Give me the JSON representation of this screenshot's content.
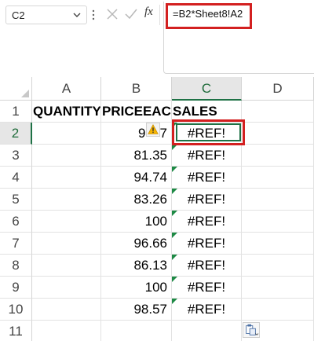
{
  "formula_bar": {
    "name_box": "C2",
    "fx_label": "fx",
    "formula": "=B2*Sheet8!A2"
  },
  "columns": [
    "A",
    "B",
    "C",
    "D"
  ],
  "rows": [
    "1",
    "2",
    "3",
    "4",
    "5",
    "6",
    "7",
    "8",
    "9",
    "10",
    "11"
  ],
  "headers": {
    "a1": "QUANTITY",
    "b1": "PRICEEACH",
    "c1": "SALES"
  },
  "b_values": [
    "9",
    "81.35",
    "94.74",
    "83.26",
    "100",
    "96.66",
    "86.13",
    "100",
    "98.57"
  ],
  "b2_tail": "7",
  "c_values": [
    "#REF!",
    "#REF!",
    "#REF!",
    "#REF!",
    "#REF!",
    "#REF!",
    "#REF!",
    "#REF!",
    "#REF!"
  ],
  "active_cell": "C2",
  "colors": {
    "highlight": "#d32020",
    "selection": "#1e7145",
    "error_triangle": "#1e8a45"
  }
}
